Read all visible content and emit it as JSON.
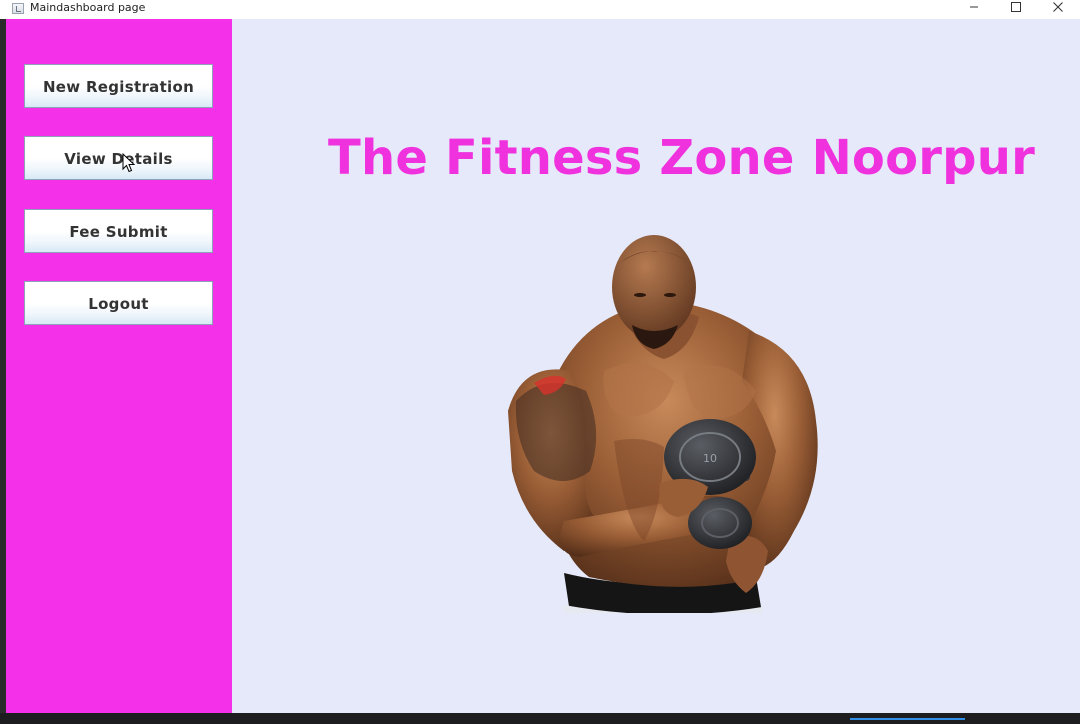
{
  "window": {
    "title": "Maindashboard page",
    "controls": {
      "minimize": "minimize-icon",
      "maximize": "maximize-icon",
      "close": "close-icon"
    }
  },
  "sidebar": {
    "background": "#f530e9",
    "buttons": [
      {
        "label": "New Registration"
      },
      {
        "label": "View Details"
      },
      {
        "label": "Fee Submit"
      },
      {
        "label": "Logout"
      }
    ]
  },
  "main": {
    "background": "#e5e9f9",
    "heading": "The Fitness Zone Noorpur",
    "heading_color": "#ef32de",
    "image": "bodybuilder-with-dumbbell",
    "dumbbell_plate_label": "10"
  }
}
